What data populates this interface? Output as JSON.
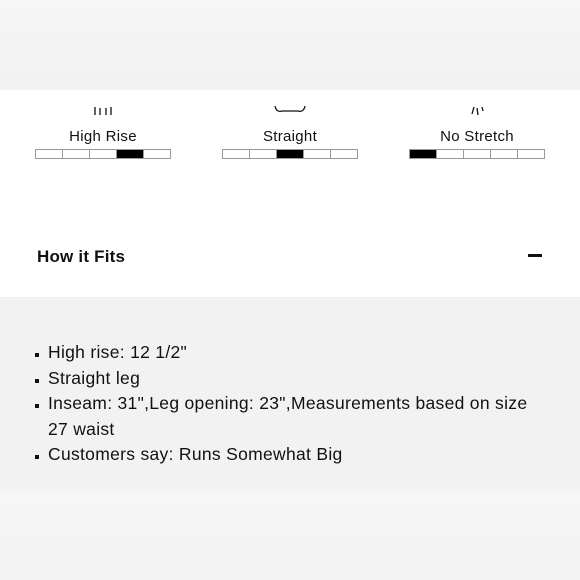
{
  "fit_attributes": [
    {
      "label": "High Rise",
      "scale_segments": 5,
      "selected_segment": 4,
      "icon": "rise-icon"
    },
    {
      "label": "Straight",
      "scale_segments": 5,
      "selected_segment": 3,
      "icon": "leg-shape-icon"
    },
    {
      "label": "No Stretch",
      "scale_segments": 5,
      "selected_segment": 1,
      "icon": "stretch-icon"
    }
  ],
  "accordion": {
    "title": "How it Fits",
    "toggle_icon": "minus-icon",
    "expanded": true,
    "items": [
      "High rise: 12 1/2\"",
      "Straight leg",
      "Inseam: 31\",Leg opening: 23\",Measurements based on size 27 waist",
      "Customers say: Runs Somewhat Big"
    ]
  },
  "colors": {
    "text": "#111111",
    "scale_fill": "#000000",
    "scale_border": "#9a9a9a",
    "panel_background": "#f2f2f2"
  }
}
